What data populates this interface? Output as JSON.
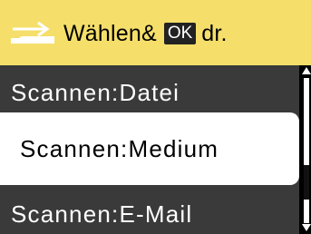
{
  "header": {
    "title_text": "Wählen&",
    "ok_label": "OK",
    "title_suffix": "dr.",
    "icon": "scan-icon",
    "background_color": "#f5df6a"
  },
  "menu": {
    "items": [
      {
        "label": "Scannen:Datei",
        "selected": false
      },
      {
        "label": "Scannen:Medium",
        "selected": true
      },
      {
        "label": "Scannen:E-Mail",
        "selected": false
      }
    ]
  },
  "colors": {
    "list_background": "#3a3a3a",
    "selected_background": "#ffffff",
    "text_default": "#ffffff",
    "text_selected": "#000000"
  }
}
